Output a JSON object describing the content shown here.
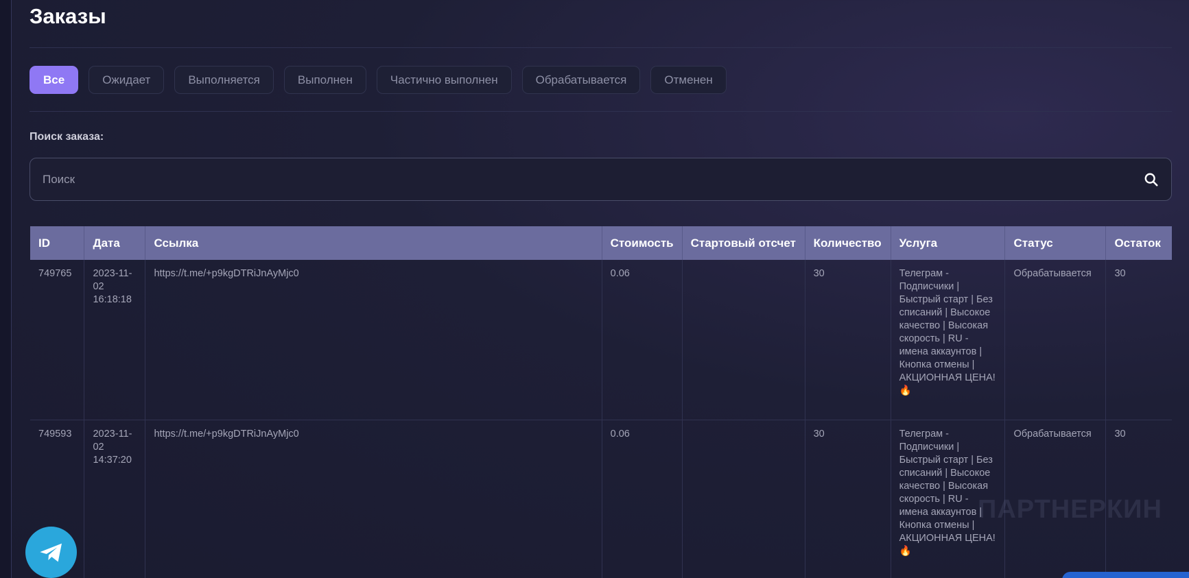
{
  "page": {
    "title": "Заказы"
  },
  "filters": [
    "Все",
    "Ожидает",
    "Выполняется",
    "Выполнен",
    "Частично выполнен",
    "Обрабатывается",
    "Отменен"
  ],
  "search": {
    "label": "Поиск заказа:",
    "placeholder": "Поиск"
  },
  "table": {
    "headers": [
      "ID",
      "Дата",
      "Ссылка",
      "Стоимость",
      "Стартовый отсчет",
      "Количество",
      "Услуга",
      "Статус",
      "Остаток"
    ],
    "rows": [
      {
        "id": "749765",
        "date": "2023-11-02 16:18:18",
        "link": "https://t.me/+p9kgDTRiJnAyMjc0",
        "cost": "0.06",
        "start": "",
        "quantity": "30",
        "service": "Телеграм - Подписчики | Быстрый старт | Без списаний | Высокое качество | Высокая скорость | RU - имена аккаунтов | Кнопка отмены | АКЦИОННАЯ ЦЕНА! 🔥",
        "status": "Обрабатывается",
        "remains": "30"
      },
      {
        "id": "749593",
        "date": "2023-11-02 14:37:20",
        "link": "https://t.me/+p9kgDTRiJnAyMjc0",
        "cost": "0.06",
        "start": "",
        "quantity": "30",
        "service": "Телеграм - Подписчики | Быстрый старт | Без списаний | Высокое качество | Высокая скорость | RU - имена аккаунтов | Кнопка отмены | АКЦИОННАЯ ЦЕНА! 🔥",
        "status": "Обрабатывается",
        "remains": "30"
      }
    ]
  },
  "watermark": "ПАРТНЕРКИН",
  "colors": {
    "accent": "#8f78f4",
    "header": "#6b6c9e",
    "telegram": "#2aa7dc"
  }
}
